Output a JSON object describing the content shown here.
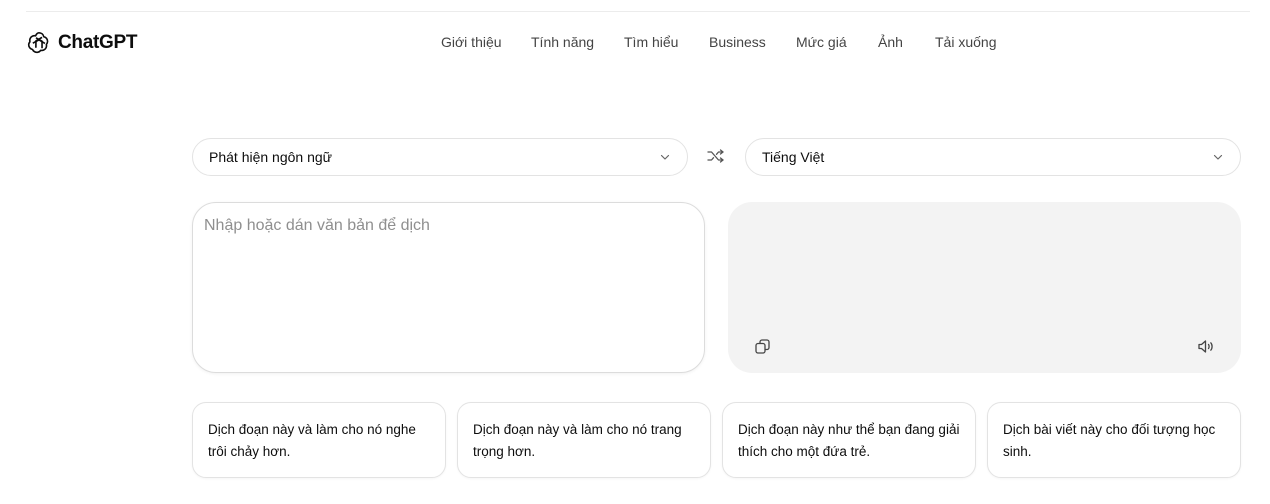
{
  "header": {
    "brand": "ChatGPT",
    "nav": [
      {
        "label": "Giới thiệu"
      },
      {
        "label": "Tính năng"
      },
      {
        "label": "Tìm hiểu"
      },
      {
        "label": "Business"
      },
      {
        "label": "Mức giá"
      },
      {
        "label": "Ảnh"
      },
      {
        "label": "Tải xuống"
      }
    ]
  },
  "translator": {
    "source_language": "Phát hiện ngôn ngữ",
    "target_language": "Tiếng Việt",
    "input_placeholder": "Nhập hoặc dán văn bản để dịch",
    "input_value": ""
  },
  "suggestions": [
    {
      "text": "Dịch đoạn này và làm cho nó nghe trôi chảy hơn."
    },
    {
      "text": "Dịch đoạn này và làm cho nó trang trọng hơn."
    },
    {
      "text": "Dịch đoạn này như thể bạn đang giải thích cho một đứa trẻ."
    },
    {
      "text": "Dịch bài viết này cho đối tượng học sinh."
    }
  ],
  "icons": {
    "logo": "openai-logo-icon",
    "swap": "shuffle-icon",
    "copy": "copy-icon",
    "speaker": "speaker-icon",
    "chevron": "chevron-down-icon"
  }
}
